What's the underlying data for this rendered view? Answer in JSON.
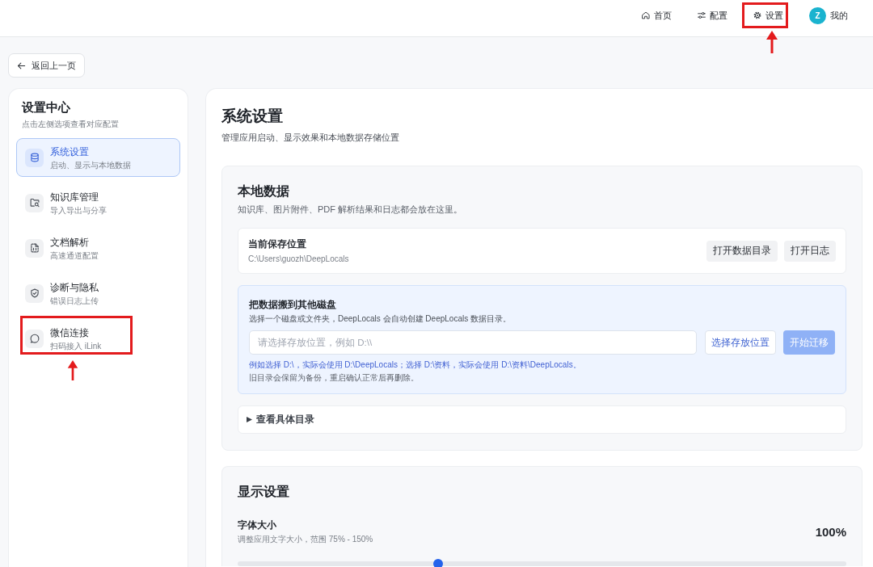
{
  "nav": {
    "items": [
      {
        "kind": "link",
        "label": "首页",
        "highlighted": false
      },
      {
        "kind": "link",
        "label": "配置",
        "highlighted": false
      },
      {
        "kind": "link",
        "label": "设置",
        "highlighted": true
      },
      {
        "kind": "profile",
        "initial": "Z",
        "label": "我的",
        "highlighted": false
      }
    ]
  },
  "back_button": {
    "label": "返回上一页"
  },
  "sidebar": {
    "title": "设置中心",
    "subtitle": "点击左侧选项查看对应配置",
    "items": [
      {
        "label": "系统设置",
        "description": "启动、显示与本地数据",
        "selected": true,
        "highlighted": false
      },
      {
        "label": "知识库管理",
        "description": "导入导出与分享",
        "selected": false,
        "highlighted": false
      },
      {
        "label": "文档解析",
        "description": "高速通道配置",
        "selected": false,
        "highlighted": false
      },
      {
        "label": "诊断与隐私",
        "description": "错误日志上传",
        "selected": false,
        "highlighted": false
      },
      {
        "label": "微信连接",
        "description": "扫码接入 iLink",
        "selected": false,
        "highlighted": true
      }
    ]
  },
  "page": {
    "title": "系统设置",
    "subtitle": "管理应用启动、显示效果和本地数据存储位置"
  },
  "local_data": {
    "title": "本地数据",
    "description": "知识库、图片附件、PDF 解析结果和日志都会放在这里。",
    "location": {
      "label": "当前保存位置",
      "path": "C:\\Users\\guozh\\DeepLocals",
      "buttons": [
        "打开数据目录",
        "打开日志"
      ]
    },
    "migrate": {
      "title": "把数据搬到其他磁盘",
      "description": "选择一个磁盘或文件夹，DeepLocals 会自动创建 DeepLocals 数据目录。",
      "input": {
        "placeholder": "请选择存放位置，例如 D:\\\\"
      },
      "choose_button": "选择存放位置",
      "start_button": {
        "label": "开始迁移",
        "disabled": true
      },
      "hint": "例如选择 D:\\，实际会使用 D:\\DeepLocals；选择 D:\\资料，实际会使用 D:\\资料\\DeepLocals。",
      "note": "旧目录会保留为备份，重启确认正常后再删除。"
    },
    "details": {
      "label": "查看具体目录",
      "expanded": false
    }
  },
  "display": {
    "title": "显示设置",
    "font_size": {
      "label": "字体大小",
      "description": "调整应用文字大小，范围 75% - 150%",
      "value": "100%",
      "level": 0.33
    }
  }
}
